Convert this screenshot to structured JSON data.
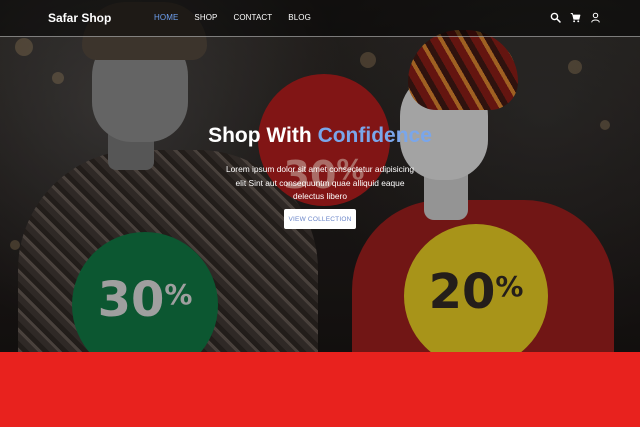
{
  "navbar": {
    "brand": "Safar Shop",
    "links": [
      {
        "label": "HOME",
        "active": true
      },
      {
        "label": "SHOP",
        "active": false
      },
      {
        "label": "CONTACT",
        "active": false
      },
      {
        "label": "BLOG",
        "active": false
      }
    ],
    "icons": [
      "search-icon",
      "cart-icon",
      "user-icon"
    ]
  },
  "hero": {
    "headline_part1": "Shop With",
    "headline_accent": "Confidence",
    "subtext": "Lorem ipsum dolor sit amet consectetur adipisicing elit Sint aut consequuntm quae alliquid eaque delectus libero",
    "cta_label": "VIEW COLLECTION",
    "stickers": [
      {
        "value": "30",
        "unit": "%",
        "color": "#0f6b3c"
      },
      {
        "value": "20",
        "unit": "%",
        "color": "#cdb51f"
      },
      {
        "value": "30",
        "unit": "%",
        "color": "#9e1a1a"
      }
    ]
  },
  "colors": {
    "accent": "#6ea0f0",
    "footer_band": "#e8221e"
  }
}
